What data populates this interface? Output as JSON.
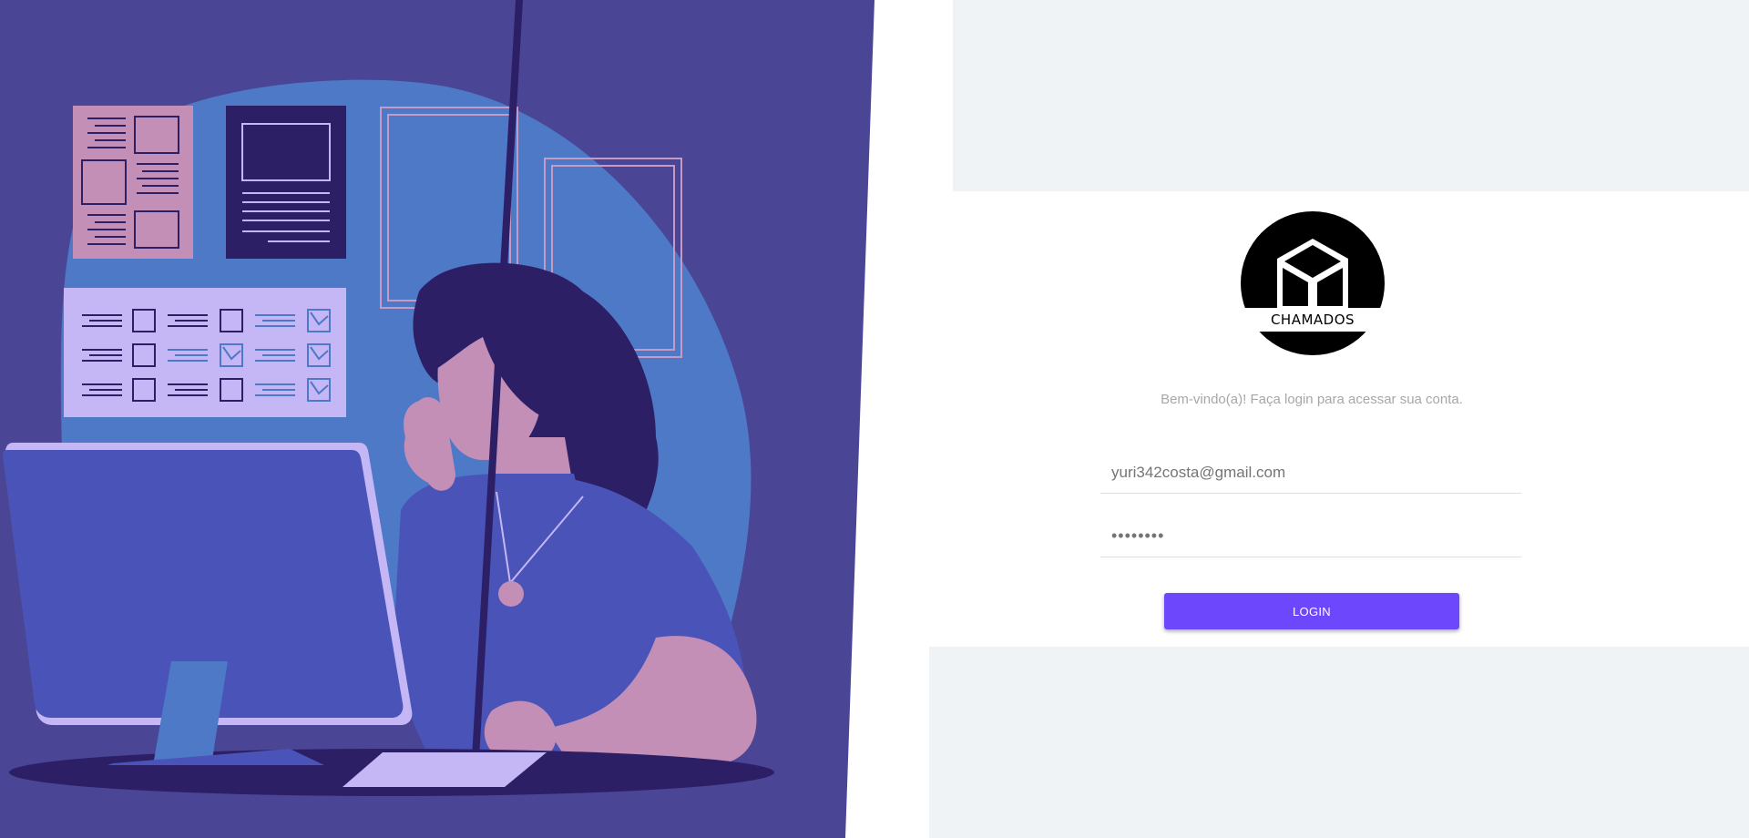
{
  "login": {
    "logo_text": "CHAMADOS",
    "welcome": "Bem-vindo(a)! Faça login para acessar sua conta.",
    "email_value": "yuri342costa@gmail.com",
    "password_value": "********",
    "button_label": "LOGIN"
  },
  "colors": {
    "hero_bg": "#4a4594",
    "blob": "#4e79c7",
    "accent": "#6d47fb",
    "panel_gray": "#f0f3f6"
  }
}
